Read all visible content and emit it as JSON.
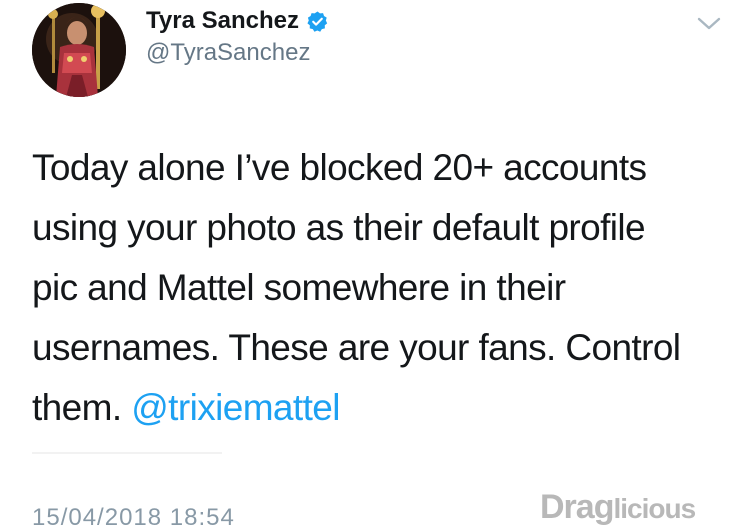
{
  "author": {
    "display_name": "Tyra Sanchez",
    "handle": "@TyraSanchez",
    "verified": true
  },
  "icons": {
    "avatar": "profile-photo",
    "verified": "verified-badge-icon",
    "menu": "chevron-down-icon"
  },
  "tweet": {
    "lines": [
      "Today alone I’ve blocked 20+ accounts",
      "using your photo as their default profile",
      "pic and Mattel somewhere in their",
      "usernames. These are your fans. Control"
    ],
    "last_line_text": "them. ",
    "mention": "@trixiemattel"
  },
  "footer": {
    "timestamp": "15/04/2018 18:54"
  },
  "watermark": {
    "prefix": "Drag",
    "suffix": "licious"
  },
  "colors": {
    "text": "#14171a",
    "secondary": "#657786",
    "link": "#1da1f2",
    "verified": "#1da1f2",
    "timestamp": "#8899a6"
  }
}
